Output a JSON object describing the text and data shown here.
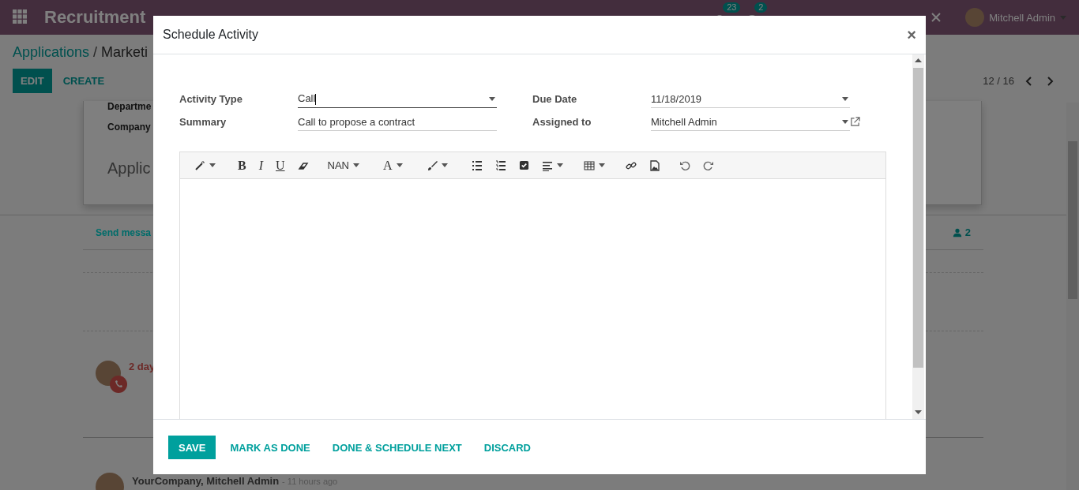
{
  "navbar": {
    "app_title": "Recruitment",
    "activity_count": "23",
    "message_count": "2",
    "user": "Mitchell Admin"
  },
  "breadcrumb": {
    "parent": "Applications",
    "separator": "/",
    "current": "Marketi"
  },
  "actions": [
    "EDIT",
    "CREATE"
  ],
  "pager": "12 / 16",
  "sheet": {
    "fields": [
      "Departme",
      "Company"
    ],
    "title": "Applic"
  },
  "chatter": {
    "send_message": "Send messa",
    "followers": "2",
    "activity_due": "2 day",
    "message_author": "YourCompany, Mitchell Admin",
    "message_time": "- 11 hours ago"
  },
  "dialog": {
    "title": "Schedule Activity",
    "close": "×",
    "fields": [
      {
        "label": "Activity Type",
        "value": "Call",
        "kind": "select",
        "focused": true
      },
      {
        "label": "Due Date",
        "value": "11/18/2019",
        "kind": "select",
        "focused": false
      },
      {
        "label": "Summary",
        "value": "Call to propose a contract",
        "kind": "text",
        "focused": false
      },
      {
        "label": "Assigned to",
        "value": "Mitchell Admin",
        "kind": "select-link",
        "focused": false
      }
    ],
    "toolbar": {
      "format": [
        "B",
        "I",
        "U"
      ],
      "font_size": "NAN",
      "font_color": "A"
    },
    "buttons": [
      {
        "label": "SAVE",
        "primary": true
      },
      {
        "label": "MARK AS DONE",
        "primary": false
      },
      {
        "label": "DONE & SCHEDULE NEXT",
        "primary": false
      },
      {
        "label": "DISCARD",
        "primary": false
      }
    ]
  }
}
